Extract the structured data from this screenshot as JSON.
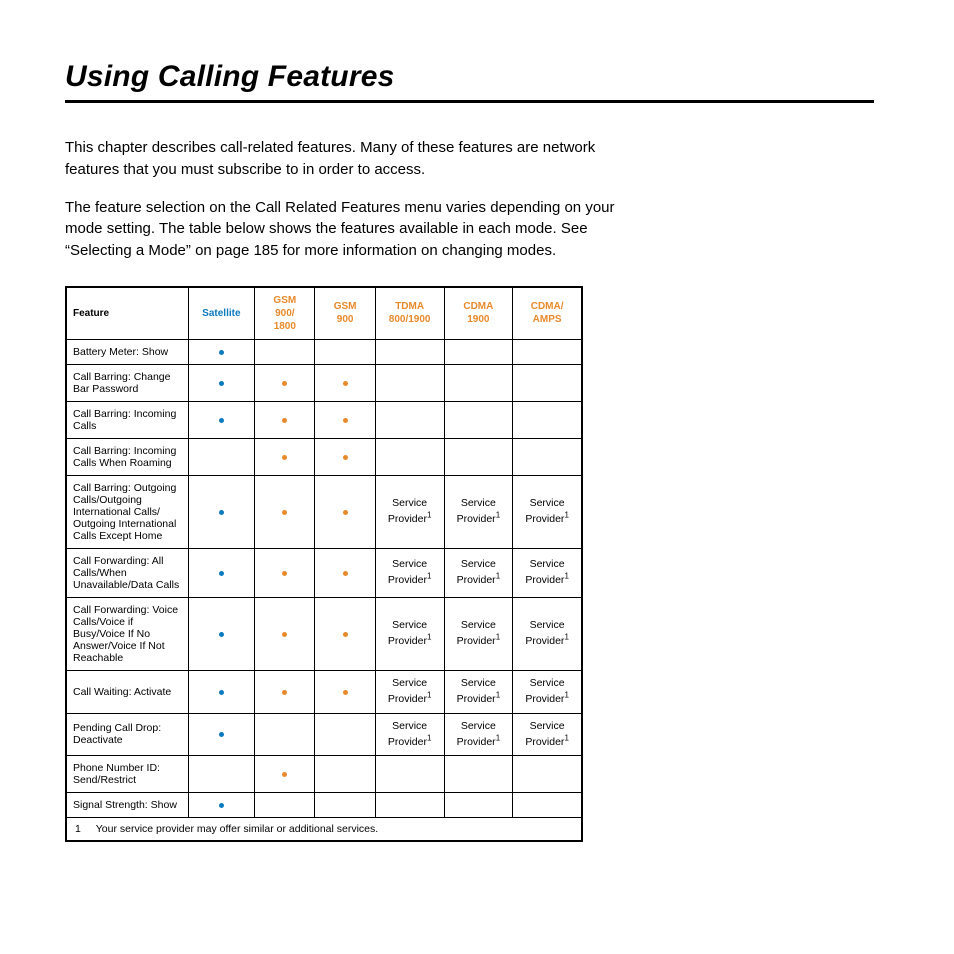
{
  "title": "Using Calling Features",
  "paragraphs": {
    "p1": "This chapter describes call-related features. Many of these features are network features that you must subscribe to in order to access.",
    "p2": "The feature selection on the Call Related Features menu varies depending on your mode setting. The table below shows the features available in each mode. See “Selecting a Mode” on page 185 for more information on changing modes."
  },
  "table": {
    "headers": {
      "feature": "Feature",
      "satellite": "Satellite",
      "gsm9001800_l1": "GSM",
      "gsm9001800_l2": "900/",
      "gsm9001800_l3": "1800",
      "gsm900_l1": "GSM",
      "gsm900_l2": "900",
      "tdma_l1": "TDMA",
      "tdma_l2": "800/1900",
      "cdma_l1": "CDMA",
      "cdma_l2": "1900",
      "cdmaamps_l1": "CDMA/",
      "cdmaamps_l2": "AMPS"
    },
    "sp_label": "Service Provider",
    "rows": [
      {
        "feature": "Battery Meter: Show",
        "cells": [
          "blue",
          "",
          "",
          "",
          "",
          ""
        ]
      },
      {
        "feature": "Call Barring: Change Bar Password",
        "cells": [
          "blue",
          "orange",
          "orange",
          "",
          "",
          ""
        ]
      },
      {
        "feature": "Call Barring: Incoming Calls",
        "cells": [
          "blue",
          "orange",
          "orange",
          "",
          "",
          ""
        ]
      },
      {
        "feature": "Call Barring: Incoming Calls When Roaming",
        "cells": [
          "",
          "orange",
          "orange",
          "",
          "",
          ""
        ]
      },
      {
        "feature": "Call Barring: Outgoing Calls/Outgoing International Calls/ Outgoing International Calls Except Home",
        "cells": [
          "blue",
          "orange",
          "orange",
          "sp",
          "sp",
          "sp"
        ]
      },
      {
        "feature": "Call Forwarding: All Calls/When Unavailable/Data Calls",
        "cells": [
          "blue",
          "orange",
          "orange",
          "sp",
          "sp",
          "sp"
        ]
      },
      {
        "feature": "Call Forwarding: Voice Calls/Voice if Busy/Voice If No Answer/Voice If Not Reachable",
        "cells": [
          "blue",
          "orange",
          "orange",
          "sp",
          "sp",
          "sp"
        ]
      },
      {
        "feature": "Call Waiting: Activate",
        "cells": [
          "blue",
          "orange",
          "orange",
          "sp",
          "sp",
          "sp"
        ]
      },
      {
        "feature": "Pending Call Drop: Deactivate",
        "cells": [
          "blue",
          "",
          "",
          "sp",
          "sp",
          "sp"
        ]
      },
      {
        "feature": "Phone Number ID: Send/Restrict",
        "cells": [
          "",
          "orange",
          "",
          "",
          "",
          ""
        ]
      },
      {
        "feature": "Signal Strength: Show",
        "cells": [
          "blue",
          "",
          "",
          "",
          "",
          ""
        ]
      }
    ],
    "footnote_num": "1",
    "footnote": "Your service provider may offer similar or additional services."
  }
}
